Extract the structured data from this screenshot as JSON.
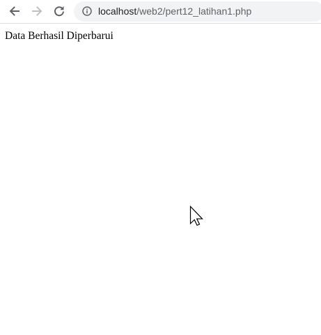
{
  "browser": {
    "toolbar": {
      "back_icon": "arrow-left-icon",
      "forward_icon": "arrow-right-icon",
      "reload_icon": "reload-icon",
      "info_icon": "info-icon",
      "address": {
        "host": "localhost",
        "path": "/web2/pert12_latihan1.php"
      }
    },
    "colors": {
      "address_bar_bg": "#f1f3f4",
      "icon_active": "#5f6368",
      "icon_disabled": "#bdc1c6"
    }
  },
  "page": {
    "message": "Data Berhasil Diperbarui"
  },
  "cursor": {
    "icon": "mouse-pointer-icon"
  }
}
